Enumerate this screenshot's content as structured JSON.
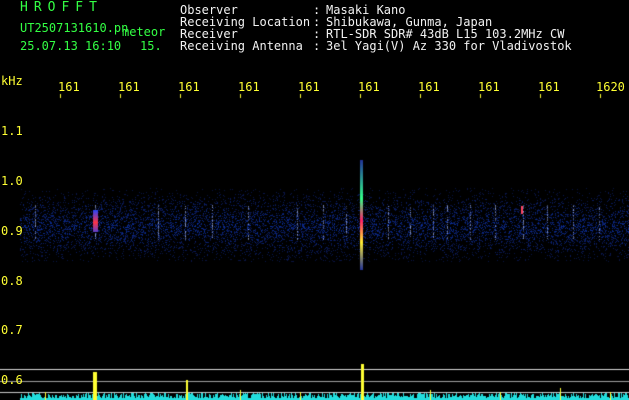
{
  "app": {
    "title": "HROFFT"
  },
  "status": {
    "file_name": "UT2507131610.pn",
    "meteor_label": "meteor",
    "date_time": "25.07.13 16:10",
    "scroll_count": "15."
  },
  "info": {
    "rows": [
      {
        "label": "Observer",
        "sep": ":",
        "value": "Masaki Kano"
      },
      {
        "label": "Receiving Location",
        "sep": ":",
        "value": "Shibukawa, Gunma, Japan"
      },
      {
        "label": "Receiver",
        "sep": ":",
        "value": "RTL-SDR SDR# 43dB L15 103.2MHz CW"
      },
      {
        "label": "Receiving Antenna",
        "sep": ":",
        "value": "3el Yagi(V) Az 330 for Vladivostok"
      }
    ]
  },
  "axis": {
    "unit": "kHz",
    "time_ticks": [
      "161",
      "161",
      "161",
      "161",
      "161",
      "161",
      "161",
      "161",
      "161",
      "1620"
    ],
    "freq_ticks": [
      "1.1",
      "1.0",
      "0.9",
      "0.8",
      "0.7",
      "0.6"
    ]
  },
  "colors": {
    "background": "#000000",
    "header_green": "#33ff44",
    "axis_yellow": "#ffff33",
    "noise_blue": "#1a2a8c",
    "echo_red": "#ff2233"
  }
}
